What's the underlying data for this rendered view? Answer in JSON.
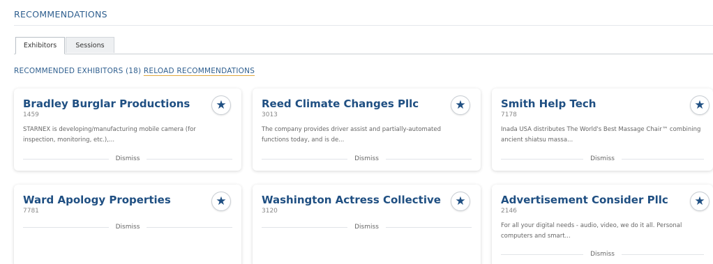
{
  "section_title": "RECOMMENDATIONS",
  "tabs": [
    {
      "label": "Exhibitors"
    },
    {
      "label": "Sessions"
    }
  ],
  "rec_header": {
    "label": "RECOMMENDED EXHIBITORS (18)",
    "reload_label": "RELOAD RECOMMENDATIONS"
  },
  "cards": [
    {
      "name": "Bradley Burglar Productions",
      "id": "1459",
      "description": "STARNEX is developing/manufacturing mobile camera (for inspection, monitoring, etc.),...",
      "dismiss_label": "Dismiss"
    },
    {
      "name": "Reed Climate Changes Pllc",
      "id": "3013",
      "description": "The company provides driver assist and partially-automated functions today, and is de...",
      "dismiss_label": "Dismiss"
    },
    {
      "name": "Smith Help Tech",
      "id": "7178",
      "description": "Inada USA distributes The World's Best Massage Chair™ combining ancient shiatsu massa...",
      "dismiss_label": "Dismiss"
    },
    {
      "name": "Ward Apology Properties",
      "id": "7781",
      "description": "",
      "dismiss_label": "Dismiss"
    },
    {
      "name": "Washington Actress Collective",
      "id": "3120",
      "description": "",
      "dismiss_label": "Dismiss"
    },
    {
      "name": "Advertisement Consider Pllc",
      "id": "2146",
      "description": "For all your digital needs - audio, video, we do it all. Personal computers and smart...",
      "dismiss_label": "Dismiss"
    }
  ],
  "icons": {
    "favorite": "star-icon"
  },
  "colors": {
    "accent": "#1f4f82",
    "header_text": "#2f5f8f",
    "reload_underline": "#e0a840"
  }
}
